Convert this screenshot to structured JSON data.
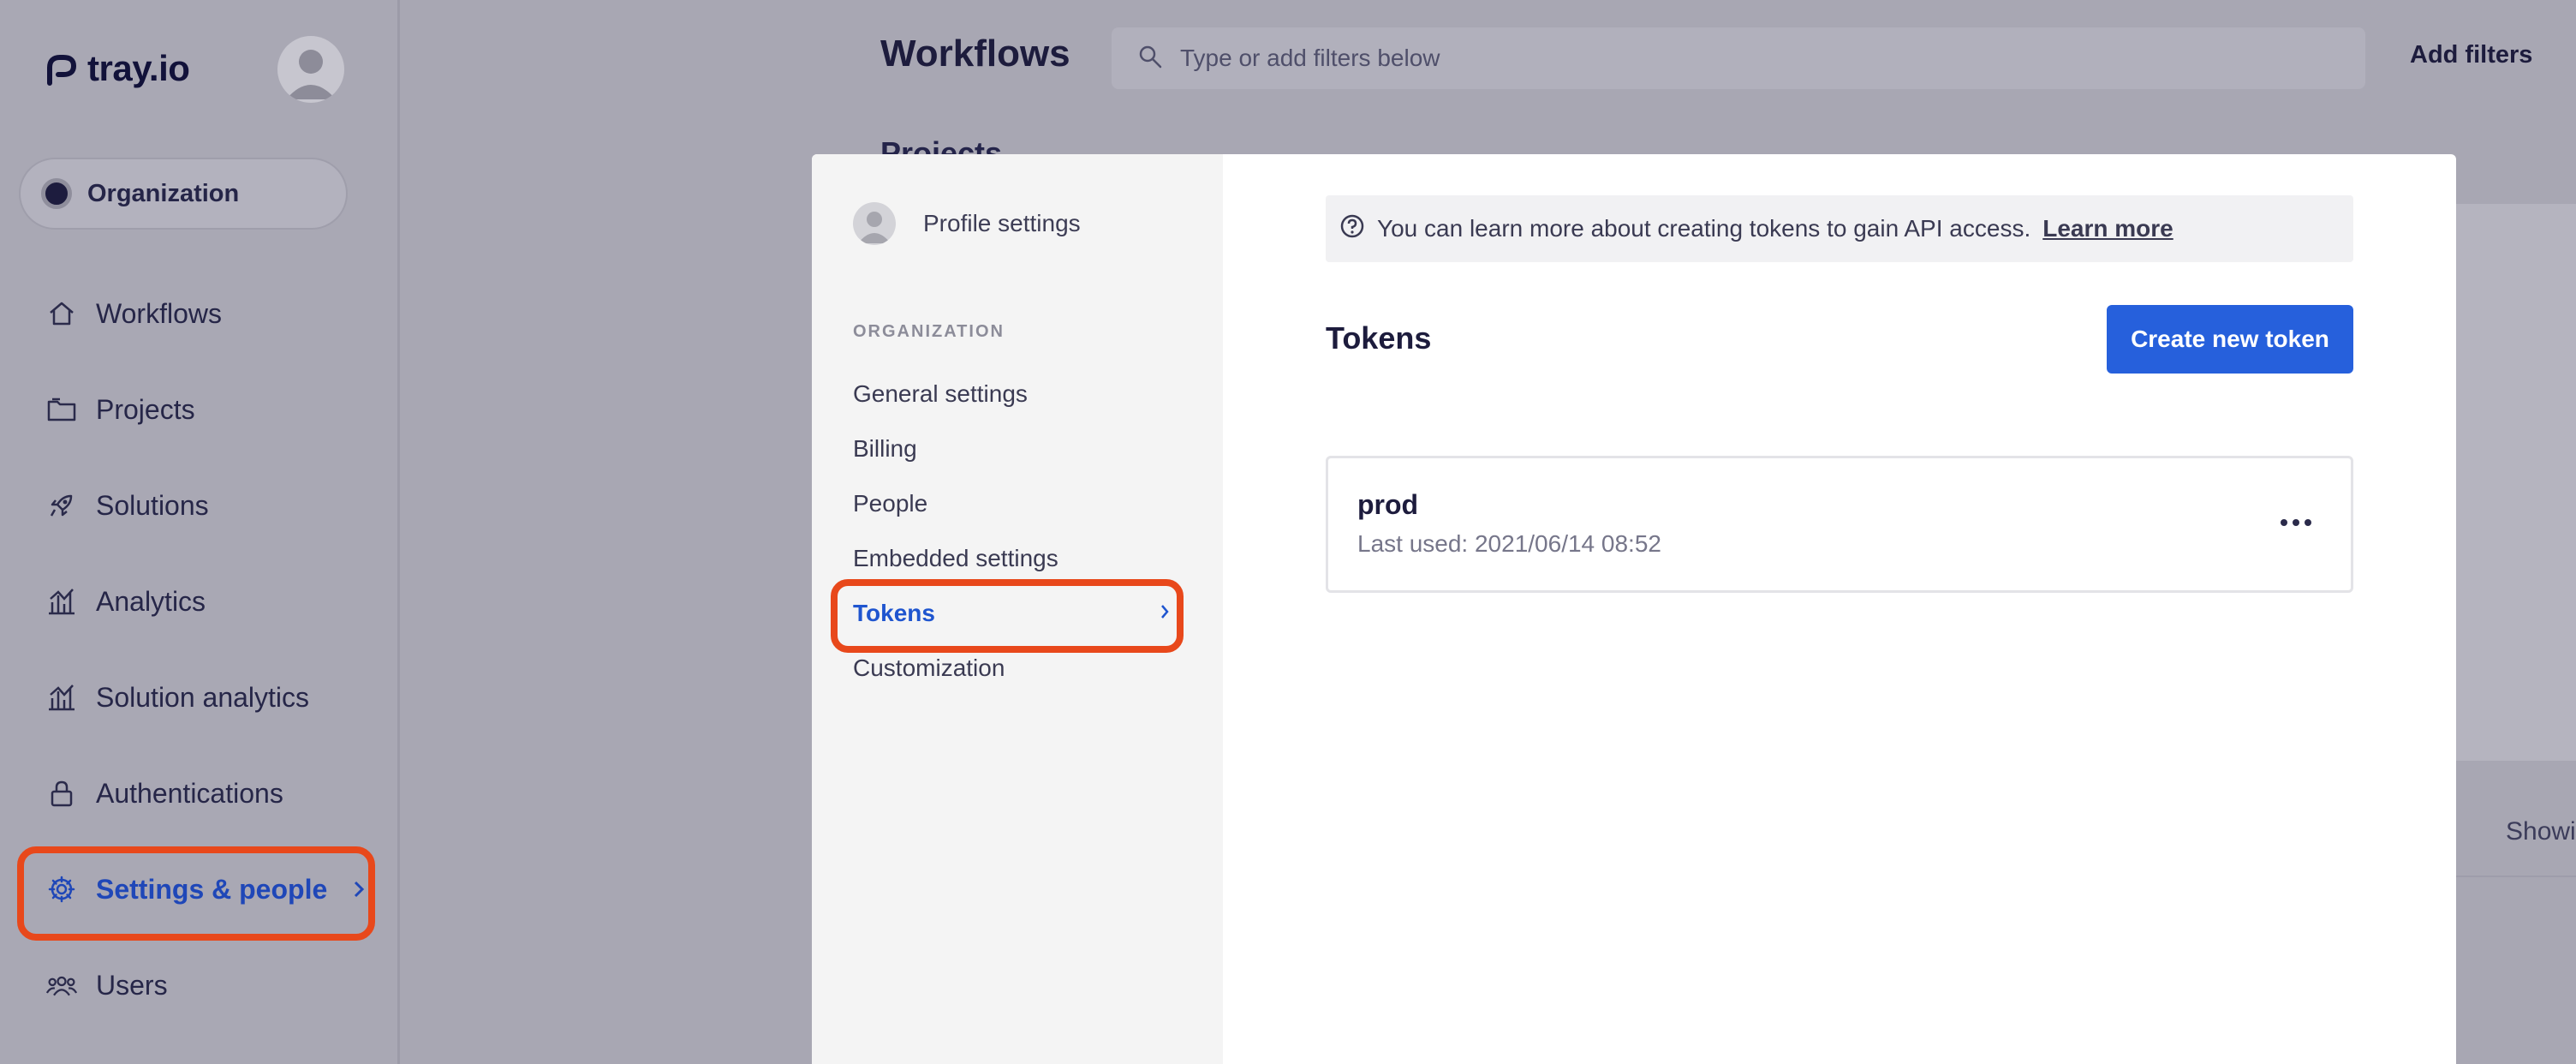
{
  "app": {
    "logo_text": "tray.io"
  },
  "sidebar": {
    "org_label": "Organization",
    "items": [
      {
        "label": "Workflows",
        "icon": "home-icon"
      },
      {
        "label": "Projects",
        "icon": "folder-icon"
      },
      {
        "label": "Solutions",
        "icon": "rocket-icon"
      },
      {
        "label": "Analytics",
        "icon": "bar-chart-icon"
      },
      {
        "label": "Solution analytics",
        "icon": "bar-chart-icon"
      },
      {
        "label": "Authentications",
        "icon": "lock-icon"
      },
      {
        "label": "Settings & people",
        "icon": "gear-icon",
        "active": true
      },
      {
        "label": "Users",
        "icon": "users-icon"
      }
    ]
  },
  "header": {
    "title": "Workflows",
    "search_placeholder": "Type or add filters below",
    "add_filters": "Add filters",
    "projects_peek": "Projects",
    "showing_peek": "Showi"
  },
  "settings_modal": {
    "profile_label": "Profile settings",
    "section_heading": "ORGANIZATION",
    "menu": [
      {
        "label": "General settings"
      },
      {
        "label": "Billing"
      },
      {
        "label": "People"
      },
      {
        "label": "Embedded settings"
      },
      {
        "label": "Tokens",
        "active": true
      },
      {
        "label": "Customization"
      }
    ],
    "info_text": "You can learn more about creating tokens to gain API access.",
    "info_link": "Learn more",
    "tokens_title": "Tokens",
    "create_button": "Create new token",
    "tokens": [
      {
        "name": "prod",
        "last_used": "Last used: 2021/06/14 08:52"
      }
    ]
  },
  "colors": {
    "accent": "#2660dc",
    "active_text": "#1f55cf",
    "highlight": "#e8481b",
    "overlay": "#a8a7b3"
  }
}
